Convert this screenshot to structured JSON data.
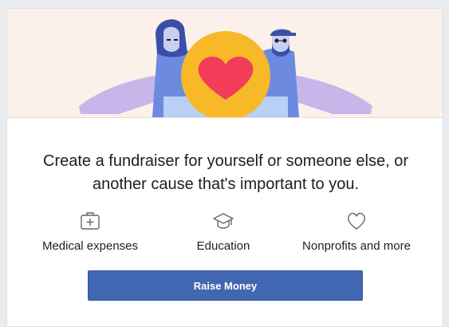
{
  "card": {
    "headline_line1": "Create a fundraiser for yourself or someone else, or",
    "headline_line2": "another cause that's important to you."
  },
  "categories": [
    {
      "label": "Medical expenses",
      "icon": "medical-kit-icon"
    },
    {
      "label": "Education",
      "icon": "graduation-cap-icon"
    },
    {
      "label": "Nonprofits and more",
      "icon": "heart-icon"
    }
  ],
  "action": {
    "raise_money_label": "Raise Money"
  },
  "colors": {
    "primary_button": "#4267b2",
    "hero_background": "#fbf1ea",
    "heart": "#f23c5a",
    "circle": "#f7b928",
    "sleeves": "#c8b6ea",
    "shirts": "#6c8be0"
  }
}
